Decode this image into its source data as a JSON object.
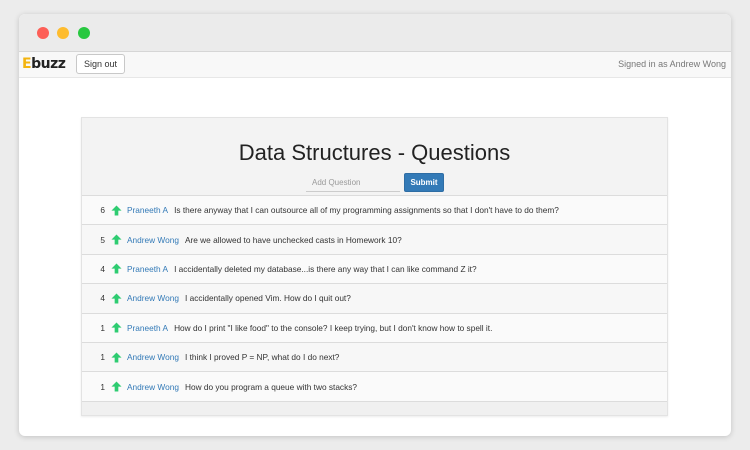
{
  "navbar": {
    "logo_first": "E",
    "logo_rest": "buzz",
    "signout_label": "Sign out",
    "signed_in_text": "Signed in as Andrew Wong"
  },
  "page": {
    "title": "Data Structures - Questions",
    "add_placeholder": "Add Question",
    "submit_label": "Submit"
  },
  "colors": {
    "accent": "#337ab7",
    "upvote": "#2ecc71",
    "logo": "#f3b40f"
  },
  "questions": [
    {
      "votes": "6",
      "author": "Praneeth A",
      "text": "Is there anyway that I can outsource all of my programming assignments so that I don't have to do them?"
    },
    {
      "votes": "5",
      "author": "Andrew Wong",
      "text": "Are we allowed to have unchecked casts in Homework 10?"
    },
    {
      "votes": "4",
      "author": "Praneeth A",
      "text": "I accidentally deleted my database...is there any way that I can like command Z it?"
    },
    {
      "votes": "4",
      "author": "Andrew Wong",
      "text": "I accidentally opened Vim. How do I quit out?"
    },
    {
      "votes": "1",
      "author": "Praneeth A",
      "text": "How do I print \"I like food\" to the console? I keep trying, but I don't know how to spell it."
    },
    {
      "votes": "1",
      "author": "Andrew Wong",
      "text": "I think I proved P = NP, what do I do next?"
    },
    {
      "votes": "1",
      "author": "Andrew Wong",
      "text": "How do you program a queue with two stacks?"
    }
  ]
}
